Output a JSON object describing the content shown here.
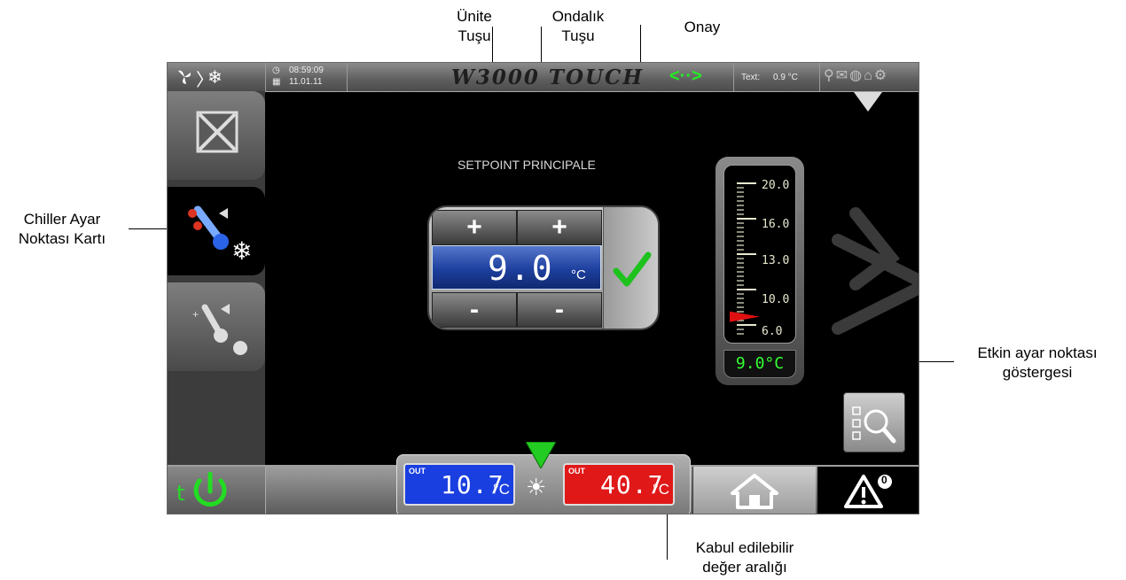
{
  "callouts": {
    "unit_key": "Ünite\nTuşu",
    "decimal_key": "Ondalık\nTuşu",
    "confirm": "Onay",
    "card": "Chiller Ayar\nNoktası Kartı",
    "active_indicator": "Etkin ayar noktası\ngöstergesi",
    "range": "Kabul edilebilir\ndeğer aralığı"
  },
  "topbar": {
    "time": "08:59:09",
    "date": "11.01.11",
    "brand": "W3000 TOUCH",
    "text_label": "Text:",
    "text_value": "0.9 °C"
  },
  "setpoint": {
    "title": "SETPOINT PRINCIPALE",
    "plus": "+",
    "minus": "-",
    "value": "9.0",
    "unit": "°C"
  },
  "gauge": {
    "ticks": [
      "20.0",
      "16.0",
      "13.0",
      "10.0",
      "6.0"
    ],
    "readout": "9.0°C",
    "marker_value": 9.0,
    "colors": {
      "readout": "#33ff33",
      "marker": "#e01010"
    }
  },
  "outputs": {
    "cold": {
      "label": "OUT",
      "value": "10.7",
      "unit": "°C",
      "color": "#1a3fe0"
    },
    "hot": {
      "label": "OUT",
      "value": "40.7",
      "unit": "°C",
      "color": "#e01818"
    }
  },
  "alarm_count": "0",
  "icons": [
    "fan-icon",
    "snowflake-icon",
    "clock-icon",
    "calendar-icon",
    "connection-icon",
    "status-icons",
    "x-icon",
    "thermometer-snow-icon",
    "thermometer-sun-icon",
    "power-icon",
    "home-icon",
    "alarm-icon",
    "search-checklist-icon",
    "check-icon"
  ]
}
